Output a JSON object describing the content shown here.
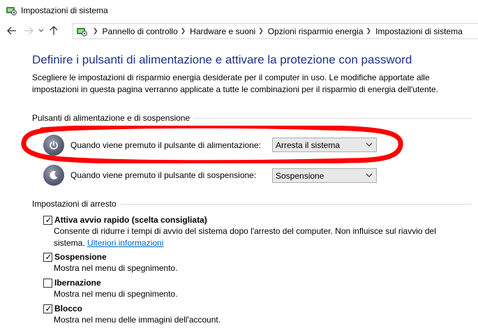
{
  "window": {
    "title": "Impostazioni di sistema"
  },
  "address_bar": {
    "crumbs": [
      "Pannello di controllo",
      "Hardware e suoni",
      "Opzioni risparmio energia",
      "Impostazioni di sistema"
    ]
  },
  "main": {
    "title": "Definire i pulsanti di alimentazione e attivare la protezione con password",
    "intro": "Scegliere le impostazioni di risparmio energia desiderate per il computer in uso. Le modifiche apportate alle impostazioni in questa pagina verranno applicate a tutte le combinazioni per il risparmio di energia dell'utente."
  },
  "power_buttons": {
    "header": "Pulsanti di alimentazione e di sospensione",
    "power_label": "Quando viene premuto il pulsante di alimentazione:",
    "power_value": "Arresta il sistema",
    "sleep_label": "Quando viene premuto il pulsante di sospensione:",
    "sleep_value": "Sospensione"
  },
  "shutdown": {
    "header": "Impostazioni di arresto",
    "items": [
      {
        "label": "Attiva avvio rapido (scelta consigliata)",
        "checked": true,
        "desc": "Consente di ridurre i tempi di avvio del sistema dopo l'arresto del computer. Non influisce sul riavvio del sistema.",
        "link": "Ulteriori informazioni"
      },
      {
        "label": "Sospensione",
        "checked": true,
        "desc": "Mostra nel menu di spegnimento."
      },
      {
        "label": "Ibernazione",
        "checked": false,
        "desc": "Mostra nel menu di spegnimento."
      },
      {
        "label": "Blocco",
        "checked": true,
        "desc": "Mostra nel menu delle immagini dell'account."
      }
    ]
  },
  "colors": {
    "title_blue": "#1e3287",
    "link_blue": "#0066cc",
    "annotation_red": "#ff0000"
  },
  "icons": {
    "app": "control-panel-icon",
    "power": "power-icon",
    "moon": "moon-icon"
  }
}
